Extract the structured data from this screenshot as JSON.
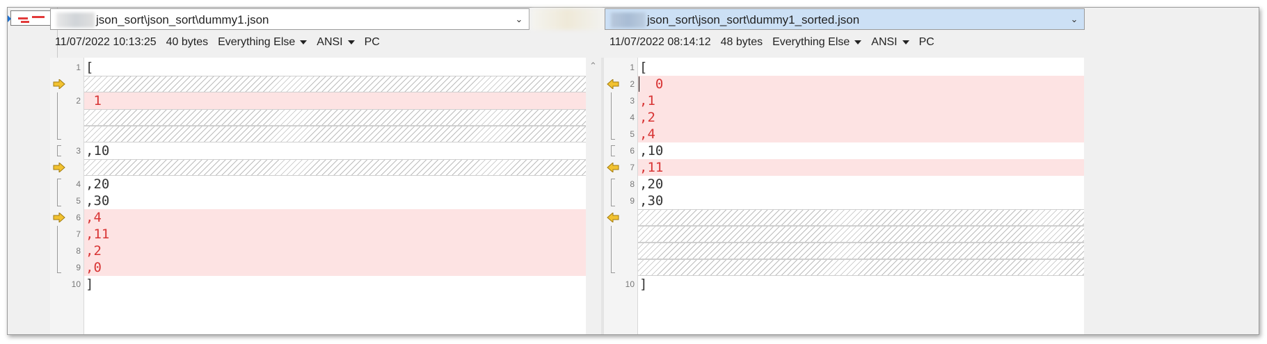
{
  "left": {
    "path": "json_sort\\json_sort\\dummy1.json",
    "date": "11/07/2022 10:13:25",
    "size": "40 bytes",
    "format": "Everything Else",
    "encoding": "ANSI",
    "line_endings": "PC",
    "lines": [
      {
        "num": "1",
        "text": "[",
        "type": "same"
      },
      {
        "num": "",
        "text": "",
        "type": "hatch"
      },
      {
        "num": "2",
        "text": " 1",
        "type": "diff"
      },
      {
        "num": "",
        "text": "",
        "type": "hatch"
      },
      {
        "num": "",
        "text": "",
        "type": "hatch"
      },
      {
        "num": "3",
        "text": ",10",
        "type": "same"
      },
      {
        "num": "",
        "text": "",
        "type": "hatch"
      },
      {
        "num": "4",
        "text": ",20",
        "type": "same"
      },
      {
        "num": "5",
        "text": ",30",
        "type": "same"
      },
      {
        "num": "6",
        "text": ",4",
        "type": "diff"
      },
      {
        "num": "7",
        "text": ",11",
        "type": "diff"
      },
      {
        "num": "8",
        "text": ",2",
        "type": "diff"
      },
      {
        "num": "9",
        "text": ",0",
        "type": "diff"
      },
      {
        "num": "10",
        "text": "]",
        "type": "same"
      }
    ]
  },
  "right": {
    "path": "json_sort\\json_sort\\dummy1_sorted.json",
    "date": "11/07/2022 08:14:12",
    "size": "48 bytes",
    "format": "Everything Else",
    "encoding": "ANSI",
    "line_endings": "PC",
    "lines": [
      {
        "num": "1",
        "text": "[",
        "type": "same"
      },
      {
        "num": "2",
        "text": "  0",
        "type": "diff"
      },
      {
        "num": "3",
        "text": ",1",
        "type": "diff"
      },
      {
        "num": "4",
        "text": ",2",
        "type": "diff"
      },
      {
        "num": "5",
        "text": ",4",
        "type": "diff"
      },
      {
        "num": "6",
        "text": ",10",
        "type": "same"
      },
      {
        "num": "7",
        "text": ",11",
        "type": "diff"
      },
      {
        "num": "8",
        "text": ",20",
        "type": "same"
      },
      {
        "num": "9",
        "text": ",30",
        "type": "same"
      },
      {
        "num": "",
        "text": "",
        "type": "hatch"
      },
      {
        "num": "",
        "text": "",
        "type": "hatch"
      },
      {
        "num": "",
        "text": "",
        "type": "hatch"
      },
      {
        "num": "",
        "text": "",
        "type": "hatch"
      },
      {
        "num": "10",
        "text": "]",
        "type": "same"
      }
    ]
  },
  "colors": {
    "diff_background": "#fde3e3",
    "diff_text": "#d83434",
    "arrow": "#f2c230",
    "active_path": "#cce0f5"
  },
  "icons": [
    "chevron-down-icon",
    "scroll-up-icon",
    "arrow-right-icon",
    "arrow-left-icon",
    "file-map-icon"
  ]
}
